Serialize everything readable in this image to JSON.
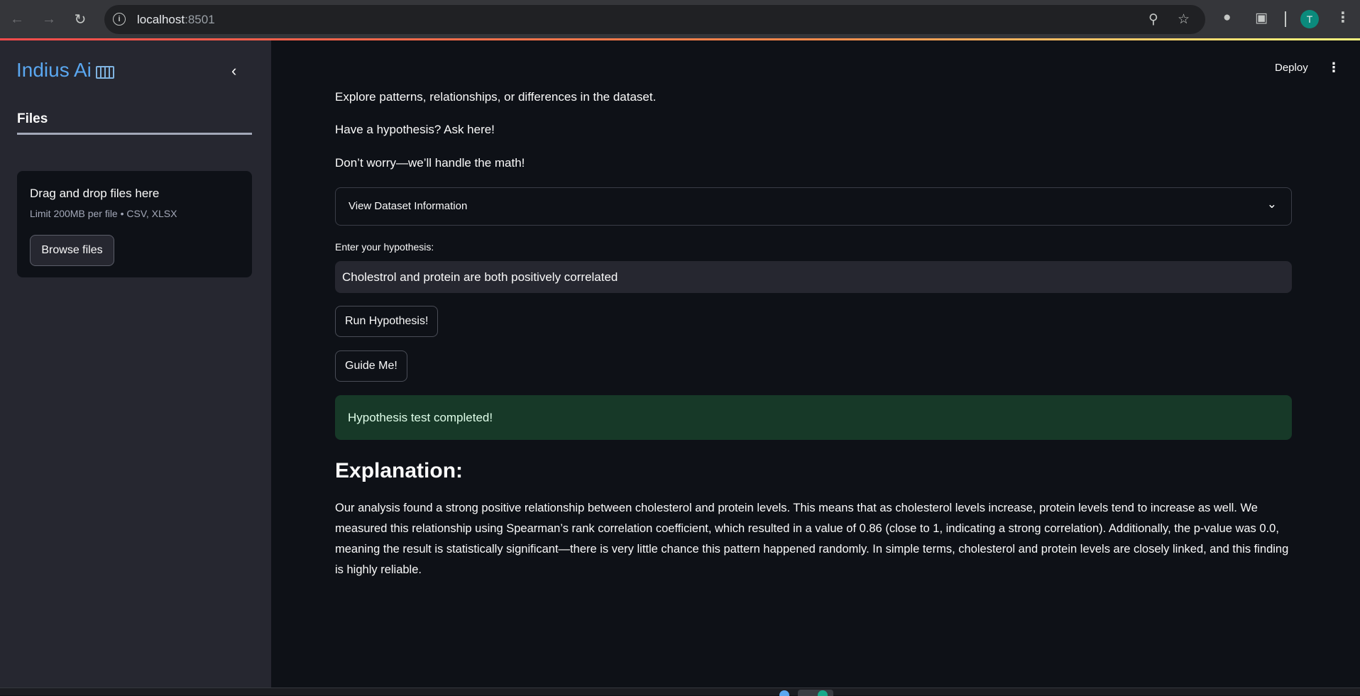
{
  "browser": {
    "url_host": "localhost",
    "url_port": ":8501",
    "avatar_letter": "T"
  },
  "sidebar": {
    "brand": "Indius Ai",
    "files_tab": "Files",
    "uploader": {
      "title": "Drag and drop files here",
      "limit": "Limit 200MB per file • CSV, XLSX",
      "browse_label": "Browse files"
    }
  },
  "header": {
    "deploy_label": "Deploy"
  },
  "main": {
    "intro_lines": [
      "Explore patterns, relationships, or differences in the dataset.",
      "Have a hypothesis? Ask here!",
      "Don’t worry—we’ll handle the math!"
    ],
    "expander_label": "View Dataset Information",
    "input_label": "Enter your hypothesis:",
    "input_value": "Cholestrol and protein are both positively correlated",
    "run_button": "Run Hypothesis!",
    "guide_button": "Guide Me!",
    "success_message": "Hypothesis test completed!",
    "explanation_heading": "Explanation:",
    "explanation_text": "Our analysis found a strong positive relationship between cholesterol and protein levels. This means that as cholesterol levels increase, protein levels tend to increase as well. We measured this relationship using Spearman’s rank correlation coefficient, which resulted in a value of 0.86 (close to 1, indicating a strong correlation). Additionally, the p-value was 0.0, meaning the result is statistically significant—there is very little chance this pattern happened randomly. In simple terms, cholesterol and protein levels are closely linked, and this finding is highly reliable."
  },
  "colors": {
    "background": "#0e1117",
    "sidebar": "#262730",
    "success_bg": "#173928",
    "brand": "#5aa7f0"
  }
}
